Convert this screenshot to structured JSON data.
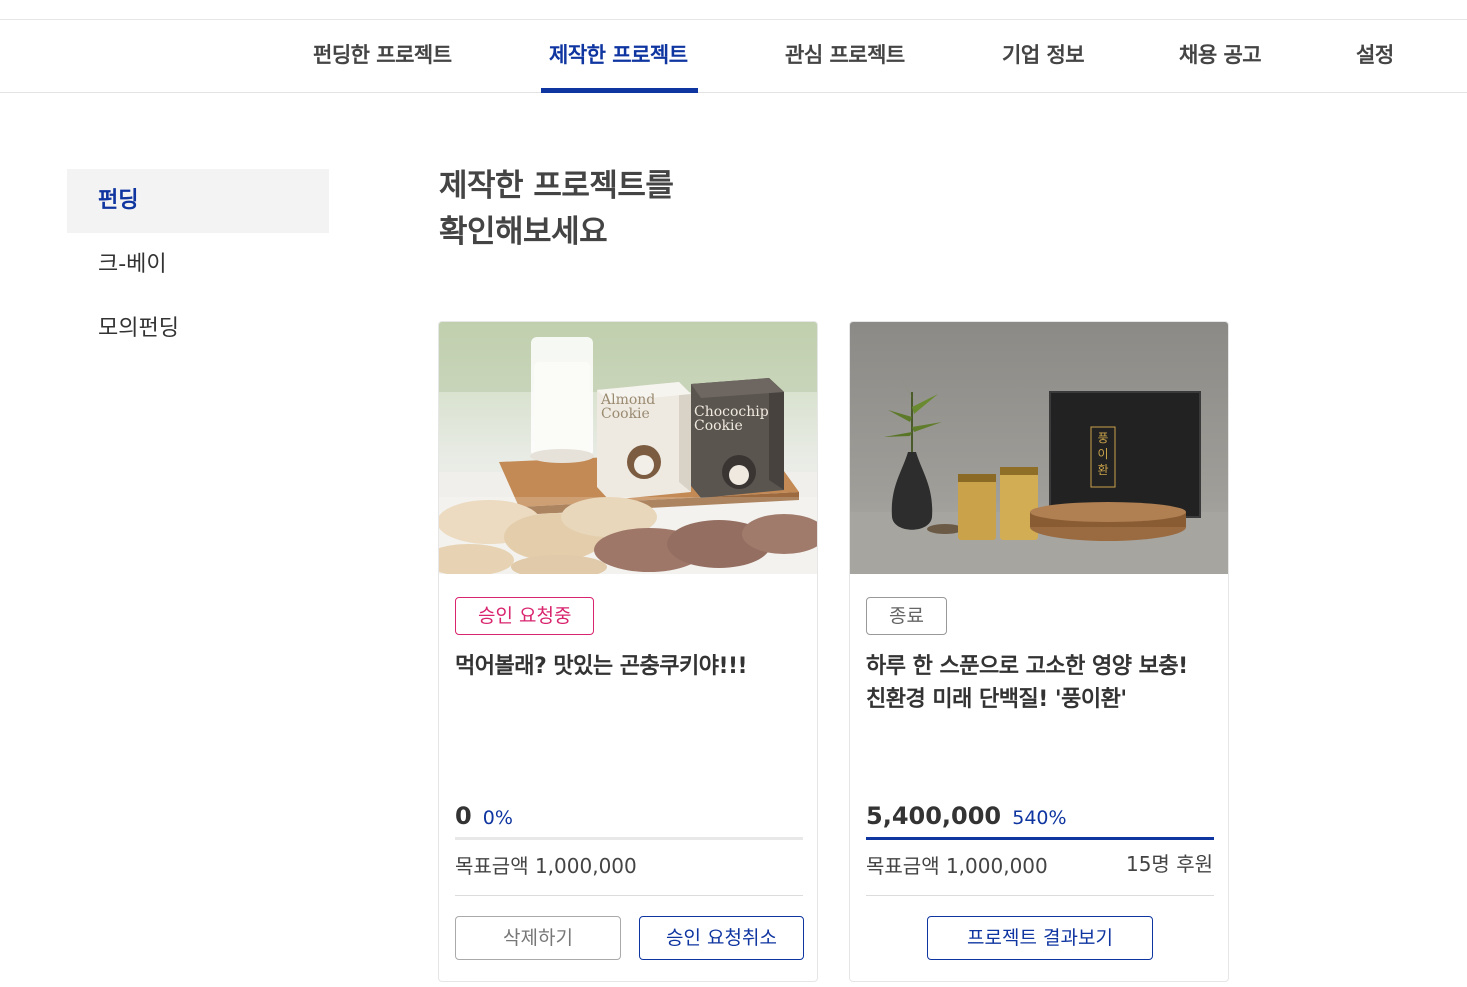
{
  "tabs": [
    {
      "label": "펀딩한 프로젝트",
      "active": false
    },
    {
      "label": "제작한 프로젝트",
      "active": true
    },
    {
      "label": "관심 프로젝트",
      "active": false
    },
    {
      "label": "기업 정보",
      "active": false
    },
    {
      "label": "채용 공고",
      "active": false
    },
    {
      "label": "설정",
      "active": false
    }
  ],
  "sidebar": {
    "items": [
      {
        "label": "펀딩",
        "active": true
      },
      {
        "label": "크-베이",
        "active": false
      },
      {
        "label": "모의펀딩",
        "active": false
      }
    ]
  },
  "heading": {
    "line1": "제작한 프로젝트를",
    "line2": "확인해보세요"
  },
  "cards": [
    {
      "badge": "승인 요청중",
      "title": "먹어볼래? 맛있는 곤충쿠키야!!!",
      "amount": "0",
      "percent": "0%",
      "progress": 0.0,
      "goal": "목표금액 1,000,000",
      "backers": "",
      "buttons": [
        "삭제하기",
        "승인 요청취소"
      ],
      "image_labels": {
        "box1": "Almond Cookie",
        "box2": "Chocochip Cookie"
      }
    },
    {
      "badge": "종료",
      "title_line1": "하루 한 스푼으로 고소한 영양 보충!",
      "title_line2": "친환경 미래 단백질! '풍이환'",
      "amount": "5,400,000",
      "percent": "540%",
      "progress": 1.0,
      "goal": "목표금액 1,000,000",
      "backers": "15명 후원",
      "buttons": [
        "프로젝트 결과보기"
      ],
      "image_labels": {
        "box": "풍이환"
      }
    }
  ],
  "colors": {
    "accent": "#0f35a0",
    "pending": "#d9246e"
  }
}
